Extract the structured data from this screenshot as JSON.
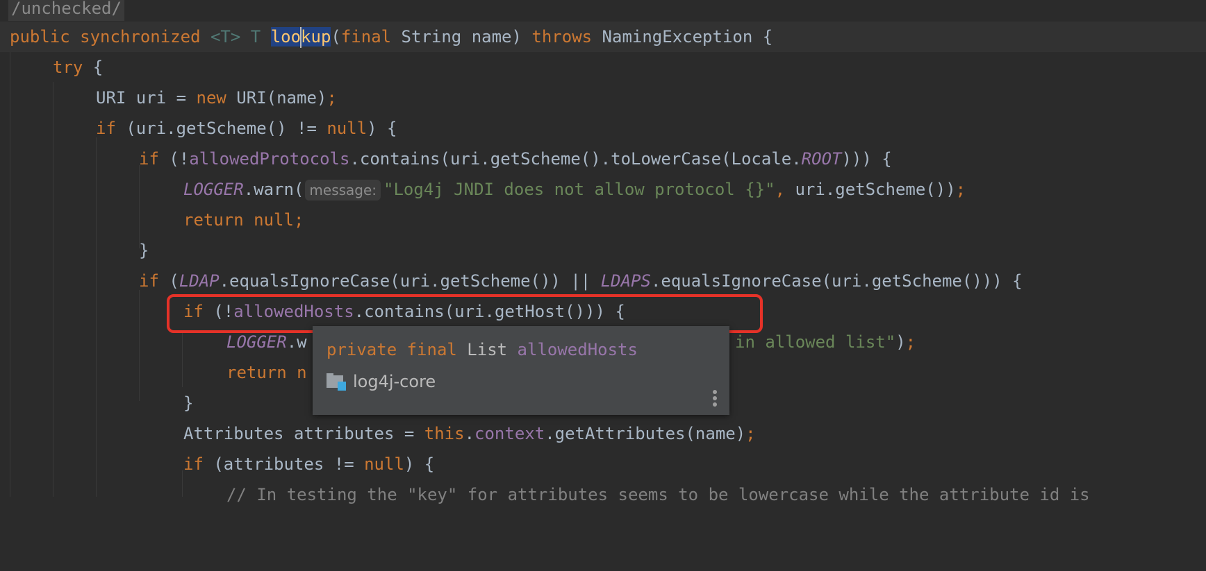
{
  "editor": {
    "annotation_label": "/unchecked/",
    "inlay_hint": "message:",
    "lines": {
      "l1": {
        "kw1": "public synchronized ",
        "tp": "<T> T ",
        "sel_a": "loo",
        "sel_b": "kup",
        "rest1": "(",
        "kw2": "final",
        "rest2": " String name) ",
        "kw3": "throws",
        "rest3": " NamingException {"
      },
      "l2": {
        "kw": "try",
        "rest": " {"
      },
      "l3": {
        "a": "URI uri = ",
        "kw": "new",
        "b": " URI(name)",
        "semi": ";"
      },
      "l4": {
        "kw": "if",
        "a": " (uri.getScheme() != ",
        "kw2": "null",
        "b": ") {"
      },
      "l5": {
        "kw": "if",
        "a": " (!",
        "field": "allowedProtocols",
        "b": ".contains(uri.getScheme().toLowerCase(Locale.",
        "static": "ROOT",
        "c": "))) {"
      },
      "l6": {
        "static": "LOGGER",
        "a": ".warn(",
        "str": "\"Log4j JNDI does not allow protocol {}\"",
        "comma": ",",
        "b": " uri.getScheme())",
        "semi": ";"
      },
      "l7": {
        "kw": "return null",
        "semi": ";"
      },
      "l8": {
        "a": "}"
      },
      "l9": {
        "kw": "if",
        "a": " (",
        "static1": "LDAP",
        "b": ".equalsIgnoreCase(uri.getScheme()) || ",
        "static2": "LDAPS",
        "c": ".equalsIgnoreCase(uri.getScheme())) {"
      },
      "l10": {
        "kw": "if",
        "a": " (!",
        "field": "allowedHosts",
        "b": ".contains(uri.getHost())) {"
      },
      "l11": {
        "static": "LOGGER",
        "a": ".w",
        "str": "in allowed list\"",
        "b": ")",
        "semi": ";"
      },
      "l12": {
        "kw": "return n"
      },
      "l13": {
        "a": "}"
      },
      "l14": {
        "a": "Attributes attributes = ",
        "kw": "this",
        "dot": ".",
        "field": "context",
        "b": ".getAttributes(name)",
        "semi": ";"
      },
      "l15": {
        "kw": "if",
        "a": " (attributes != ",
        "kw2": "null",
        "b": ") {"
      },
      "l16": {
        "cmt": "// In testing the \"key\" for attributes seems to be lowercase while the attribute id is"
      }
    }
  },
  "popup": {
    "modifiers": "private final",
    "type": "List",
    "name": "allowedHosts",
    "module": "log4j-core"
  }
}
